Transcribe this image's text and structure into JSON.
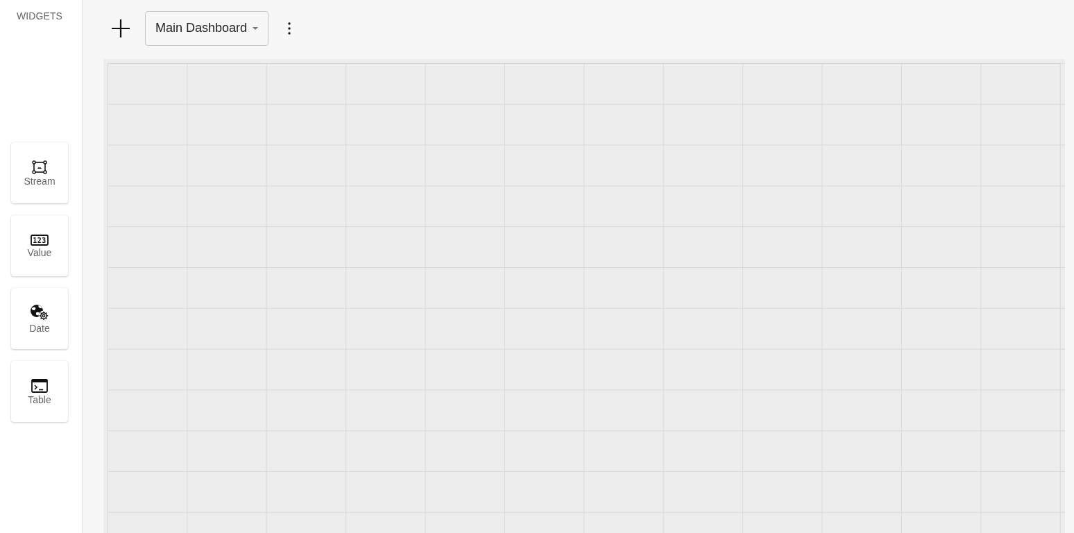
{
  "sidebar": {
    "title": "WIDGETS",
    "widgets": [
      {
        "label": "Stream"
      },
      {
        "label": "Value",
        "icon_text": "123"
      },
      {
        "label": "Date"
      },
      {
        "label": "Table"
      }
    ]
  },
  "toolbar": {
    "dashboard_select": {
      "value": "Main Dashboard"
    }
  }
}
